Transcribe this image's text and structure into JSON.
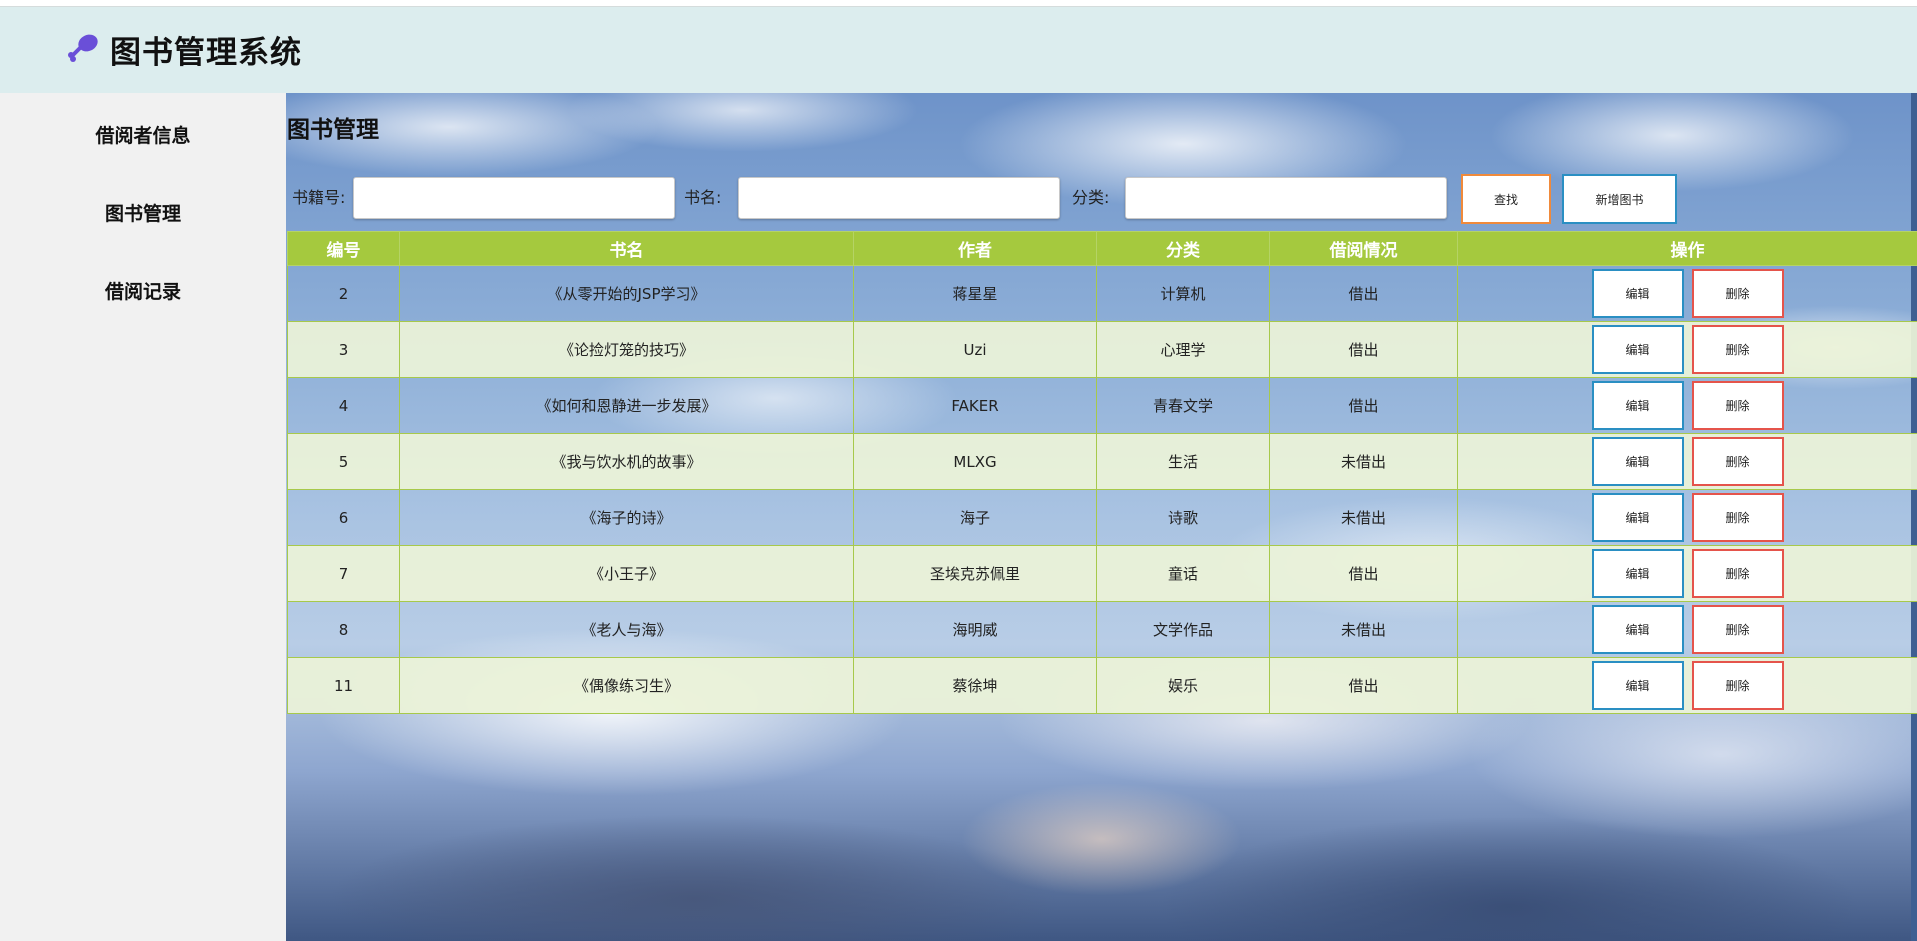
{
  "app": {
    "title": "图书管理系统",
    "logo_icon": "drumstick-icon",
    "logo_color": "#6a4fd8"
  },
  "sidebar": {
    "items": [
      {
        "label": "借阅者信息"
      },
      {
        "label": "图书管理"
      },
      {
        "label": "借阅记录"
      }
    ]
  },
  "main": {
    "title": "图书管理",
    "search": {
      "book_no_label": "书籍号:",
      "book_no_value": "",
      "book_name_label": "书名:",
      "book_name_value": "",
      "category_label": "分类:",
      "category_value": "",
      "search_button": "查找",
      "add_button": "新增图书"
    },
    "table": {
      "headers": [
        "编号",
        "书名",
        "作者",
        "分类",
        "借阅情况",
        "操作"
      ],
      "edit_label": "编辑",
      "delete_label": "删除",
      "rows": [
        {
          "id": "2",
          "name": "《从零开始的JSP学习》",
          "author": "蒋星星",
          "category": "计算机",
          "status": "借出"
        },
        {
          "id": "3",
          "name": "《论捡灯笼的技巧》",
          "author": "Uzi",
          "category": "心理学",
          "status": "借出"
        },
        {
          "id": "4",
          "name": "《如何和恩静进一步发展》",
          "author": "FAKER",
          "category": "青春文学",
          "status": "借出"
        },
        {
          "id": "5",
          "name": "《我与饮水机的故事》",
          "author": "MLXG",
          "category": "生活",
          "status": "未借出"
        },
        {
          "id": "6",
          "name": "《海子的诗》",
          "author": "海子",
          "category": "诗歌",
          "status": "未借出"
        },
        {
          "id": "7",
          "name": "《小王子》",
          "author": "圣埃克苏佩里",
          "category": "童话",
          "status": "借出"
        },
        {
          "id": "8",
          "name": "《老人与海》",
          "author": "海明威",
          "category": "文学作品",
          "status": "未借出"
        },
        {
          "id": "11",
          "name": "《偶像练习生》",
          "author": "蔡徐坤",
          "category": "娱乐",
          "status": "借出"
        }
      ]
    }
  },
  "colors": {
    "header_bg": "#dcedee",
    "sidebar_bg": "#f1f1f1",
    "table_header_bg": "#a5c93e",
    "status_out": "#ff1a1a",
    "search_button_border": "#f08a3b",
    "edit_button_border": "#2a8fc3",
    "delete_button_border": "#e5544b"
  }
}
